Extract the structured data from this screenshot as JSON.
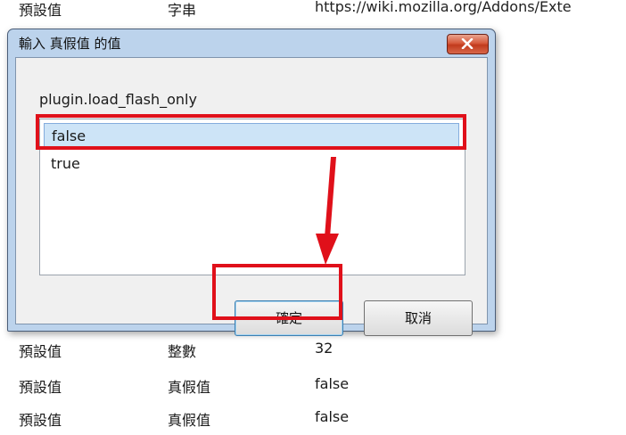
{
  "background": {
    "url_fragment": "https://wiki.mozilla.org/Addons/Exte",
    "top_row": [
      "預設值",
      "字串"
    ],
    "rows": [
      [
        "預設值",
        "整數",
        "32"
      ],
      [
        "預設值",
        "真假值",
        "false"
      ],
      [
        "預設值",
        "真假值",
        "false"
      ]
    ]
  },
  "dialog": {
    "title": "輸入 真假值 的值",
    "pref_name": "plugin.load_flash_only",
    "options": [
      "false",
      "true"
    ],
    "selected_option": "false",
    "ok_label": "確定",
    "cancel_label": "取消"
  },
  "annotation_color": "#e0101a"
}
